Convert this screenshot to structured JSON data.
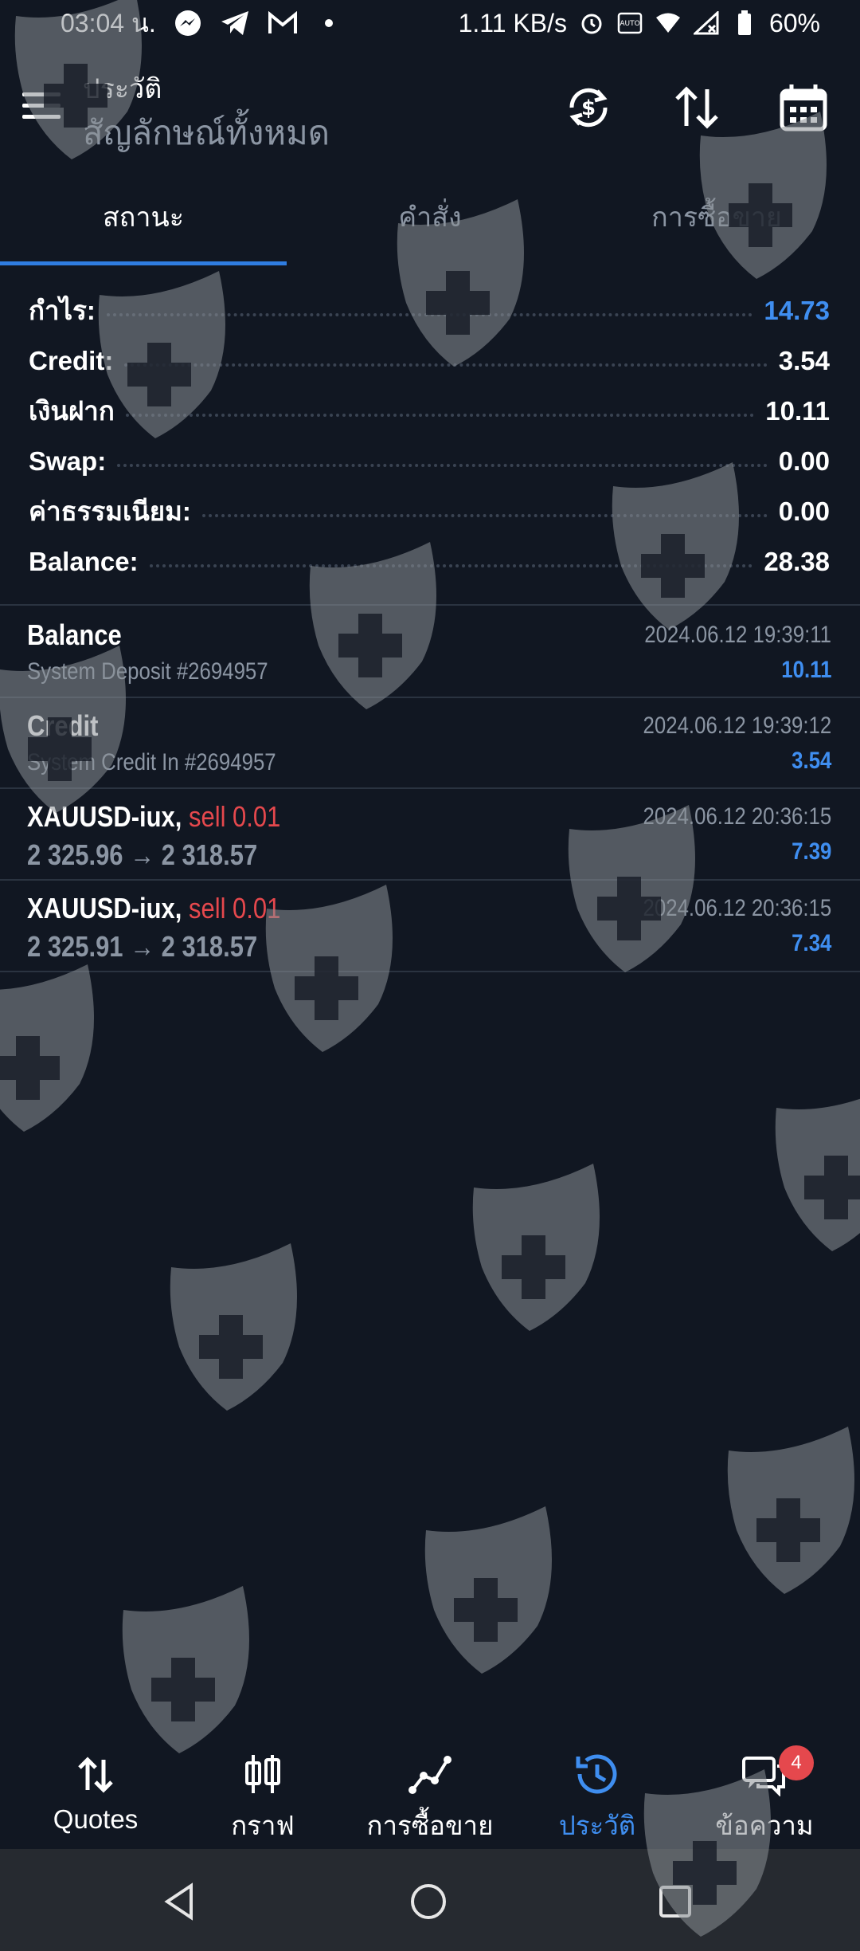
{
  "status_bar": {
    "time": "03:04 น.",
    "speed": "1.11 KB/s",
    "battery": "60%"
  },
  "header": {
    "title": "ประวัติ",
    "subtitle": "สัญลักษณ์ทั้งหมด"
  },
  "tabs": [
    {
      "label": "สถานะ",
      "active": true
    },
    {
      "label": "คำสั่ง",
      "active": false
    },
    {
      "label": "การซื้อขาย",
      "active": false
    }
  ],
  "summary": [
    {
      "label": "กำไร:",
      "value": "14.73",
      "highlight": true
    },
    {
      "label": "Credit:",
      "value": "3.54",
      "highlight": false
    },
    {
      "label": "เงินฝาก",
      "value": "10.11",
      "highlight": false
    },
    {
      "label": "Swap:",
      "value": "0.00",
      "highlight": false
    },
    {
      "label": "ค่าธรรมเนียม:",
      "value": "0.00",
      "highlight": false
    },
    {
      "label": "Balance:",
      "value": "28.38",
      "highlight": false
    }
  ],
  "deals": [
    {
      "name": "Balance",
      "detail": "System Deposit #2694957",
      "datetime": "2024.06.12 19:39:11",
      "amount": "10.11"
    },
    {
      "name": "Credit",
      "detail": "System Credit In #2694957",
      "datetime": "2024.06.12 19:39:12",
      "amount": "3.54"
    },
    {
      "name": "XAUUSD-iux,",
      "action": "sell 0.01",
      "prices": "2 325.96 → 2 318.57",
      "datetime": "2024.06.12 20:36:15",
      "amount": "7.39"
    },
    {
      "name": "XAUUSD-iux,",
      "action": "sell 0.01",
      "prices": "2 325.91 → 2 318.57",
      "datetime": "2024.06.12 20:36:15",
      "amount": "7.34"
    }
  ],
  "bottom_nav": [
    {
      "label": "Quotes",
      "icon": "quotes-arrows-icon",
      "active": false
    },
    {
      "label": "กราฟ",
      "icon": "candlestick-icon",
      "active": false
    },
    {
      "label": "การซื้อขาย",
      "icon": "trade-line-icon",
      "active": false
    },
    {
      "label": "ประวัติ",
      "icon": "history-clock-icon",
      "active": true
    },
    {
      "label": "ข้อความ",
      "icon": "chat-bubbles-icon",
      "active": false,
      "badge": "4"
    }
  ],
  "colors": {
    "background": "#111722",
    "accent": "#3f8ef0",
    "sell": "#e5484d",
    "muted": "#8b95a3"
  }
}
